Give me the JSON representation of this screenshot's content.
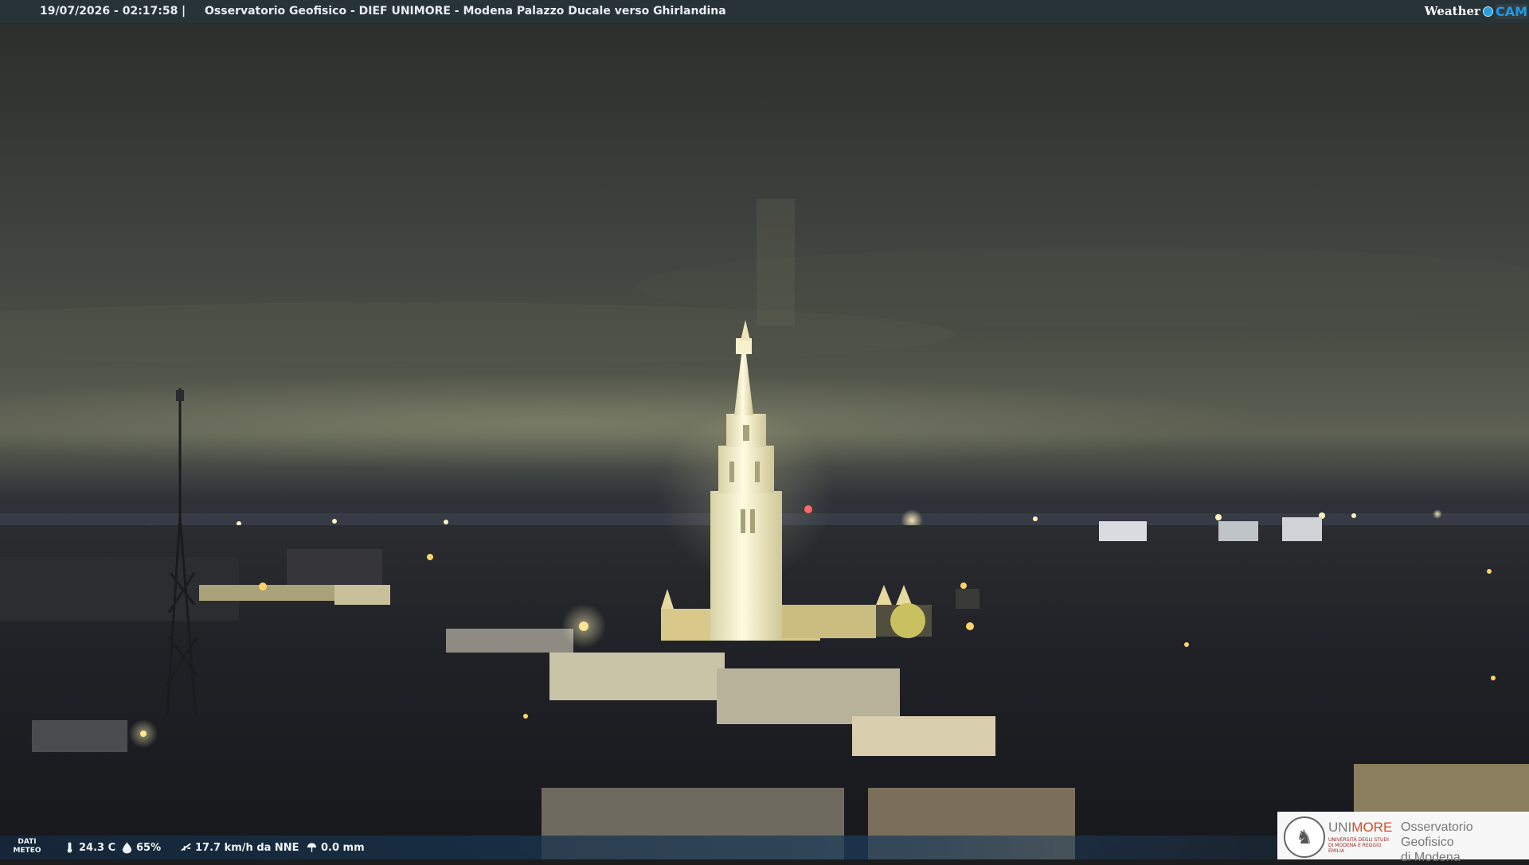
{
  "header": {
    "datetime": "19/07/2026 - 02:17:58",
    "separator": "|",
    "title": "Osservatorio Geofisico - DIEF UNIMORE - Modena Palazzo Ducale verso Ghirlandina",
    "brand_weather": "Weather",
    "brand_cam": "CAM"
  },
  "weather_bar": {
    "label_line1": "DATI",
    "label_line2": "METEO",
    "temperature": "24.3 C",
    "humidity": "65%",
    "wind": "17.7 km/h da NNE",
    "rain": "0.0 mm",
    "icons": [
      "thermometer-icon",
      "humidity-drop-icon",
      "wind-icon",
      "rain-icon"
    ]
  },
  "logo": {
    "uni_part1": "UNI",
    "uni_part2": "MORE",
    "uni_sub": "UNIVERSITÀ DEGLI STUDI DI MODENA E REGGIO EMILIA",
    "obs_line1": "Osservatorio Geofisico",
    "obs_line2": "di Modena"
  },
  "colors": {
    "sky": "#3a3d3a",
    "tower_light": "#f6f0c8",
    "city_lights": "#ffd36a",
    "brand_blue": "#1e9be6",
    "uni_red": "#d94a2a"
  }
}
